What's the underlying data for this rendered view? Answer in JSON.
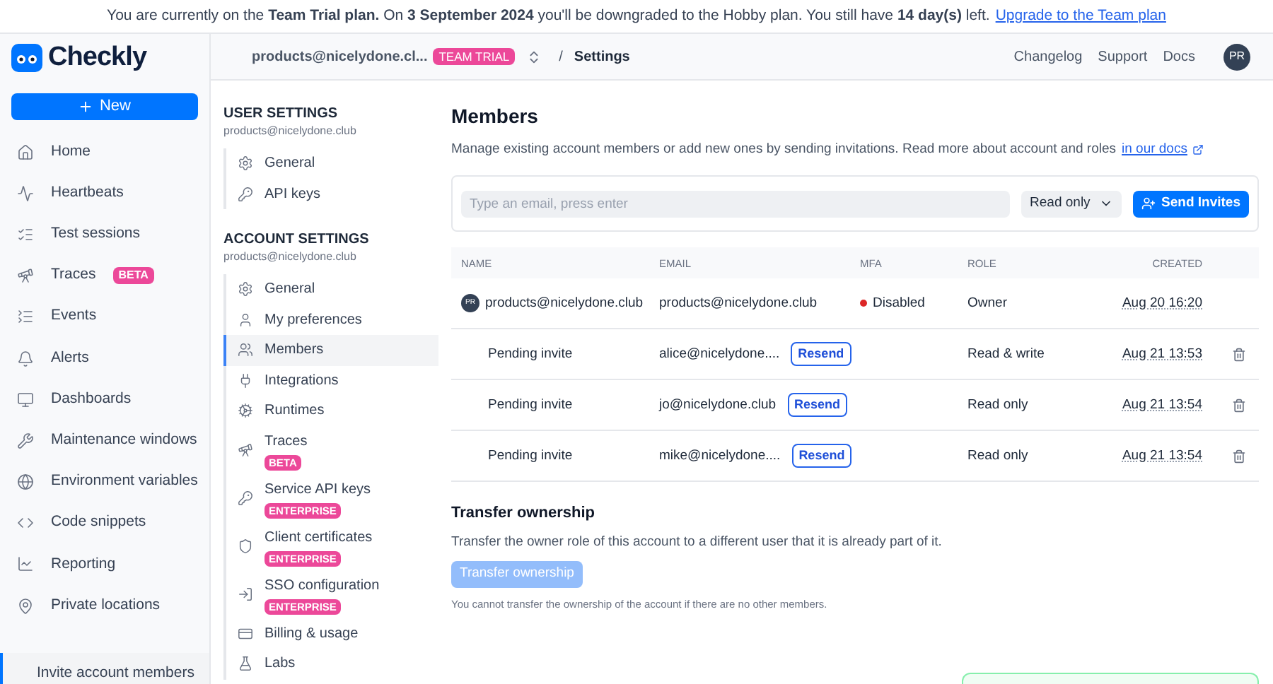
{
  "banner": {
    "text": "You are currently on the **Team Trial plan.** On **3 September 2024** you'll be downgraded to the Hobby plan. You still have **14 day(s)** left.",
    "link": "Upgrade to the Team plan"
  },
  "sidebar": {
    "logo": "Checkly",
    "new_button": "New",
    "items": [
      {
        "label": "Home",
        "selected": false
      },
      {
        "label": "Heartbeats",
        "selected": false
      },
      {
        "label": "Test sessions",
        "selected": false
      },
      {
        "label": "Traces",
        "badge": "BETA",
        "selected": false
      },
      {
        "label": "Events",
        "selected": false
      },
      {
        "label": "Alerts",
        "selected": false
      },
      {
        "label": "Dashboards",
        "selected": false
      },
      {
        "label": "Maintenance windows",
        "selected": false
      },
      {
        "label": "Environment variables",
        "selected": false
      },
      {
        "label": "Code snippets",
        "selected": false
      },
      {
        "label": "Reporting",
        "selected": false
      },
      {
        "label": "Private locations",
        "selected": false
      }
    ],
    "bottom_item": {
      "label": "Invite account members",
      "selected": true
    }
  },
  "topbar": {
    "account": "products@nicelydone.cl...",
    "plan_badge": "TEAM TRIAL",
    "separator": "/",
    "page": "Settings",
    "links": [
      "Changelog",
      "Support",
      "Docs"
    ],
    "avatar": "PR"
  },
  "settings_nav": {
    "sections": [
      {
        "title": "USER SETTINGS",
        "subtitle": "products@nicelydone.club",
        "items": [
          {
            "label": "General",
            "selected": false
          },
          {
            "label": "API keys",
            "selected": false
          }
        ]
      },
      {
        "title": "ACCOUNT SETTINGS",
        "subtitle": "products@nicelydone.club",
        "items": [
          {
            "label": "General",
            "selected": false
          },
          {
            "label": "My preferences",
            "selected": false
          },
          {
            "label": "Members",
            "selected": true
          },
          {
            "label": "Integrations",
            "selected": false
          },
          {
            "label": "Runtimes",
            "selected": false
          },
          {
            "label": "Traces",
            "badge": "BETA",
            "selected": false
          },
          {
            "label": "Service API keys",
            "badge": "ENTERPRISE",
            "selected": false
          },
          {
            "label": "Client certificates",
            "badge": "ENTERPRISE",
            "selected": false
          },
          {
            "label": "SSO configuration",
            "badge": "ENTERPRISE",
            "selected": false
          },
          {
            "label": "Billing & usage",
            "selected": false
          },
          {
            "label": "Labs",
            "selected": false
          }
        ]
      }
    ]
  },
  "main": {
    "title": "Members",
    "description": "Manage existing account members or add new ones by sending invitations. Read more about account and roles",
    "docs_link": "in our docs",
    "invite": {
      "placeholder": "Type an email, press enter",
      "role": "Read only",
      "button": "Send Invites"
    },
    "table": {
      "columns": [
        "NAME",
        "EMAIL",
        "MFA",
        "ROLE",
        "CREATED"
      ],
      "rows": [
        {
          "kind": "member",
          "avatar": "PR",
          "name": "products@nicelydone.club",
          "email": "products@nicelydone.club",
          "mfa": "Disabled",
          "color": "#dc2626",
          "role": "Owner",
          "created": "Aug 20 16:20"
        },
        {
          "kind": "pending",
          "name": "Pending invite",
          "email": "alice@nicelydone....",
          "resend": "Resend",
          "role": "Read & write",
          "created": "Aug 21 13:53"
        },
        {
          "kind": "pending",
          "name": "Pending invite",
          "email": "jo@nicelydone.club",
          "resend": "Resend",
          "role": "Read only",
          "created": "Aug 21 13:54"
        },
        {
          "kind": "pending",
          "name": "Pending invite",
          "email": "mike@nicelydone....",
          "resend": "Resend",
          "role": "Read only",
          "created": "Aug 21 13:54"
        }
      ]
    },
    "transfer": {
      "title": "Transfer ownership",
      "description": "Transfer the owner role of this account to a different user that it is already part of it.",
      "button": "Transfer ownership",
      "disabled": true,
      "note": "You cannot transfer the ownership of the account if there are no other members."
    }
  }
}
